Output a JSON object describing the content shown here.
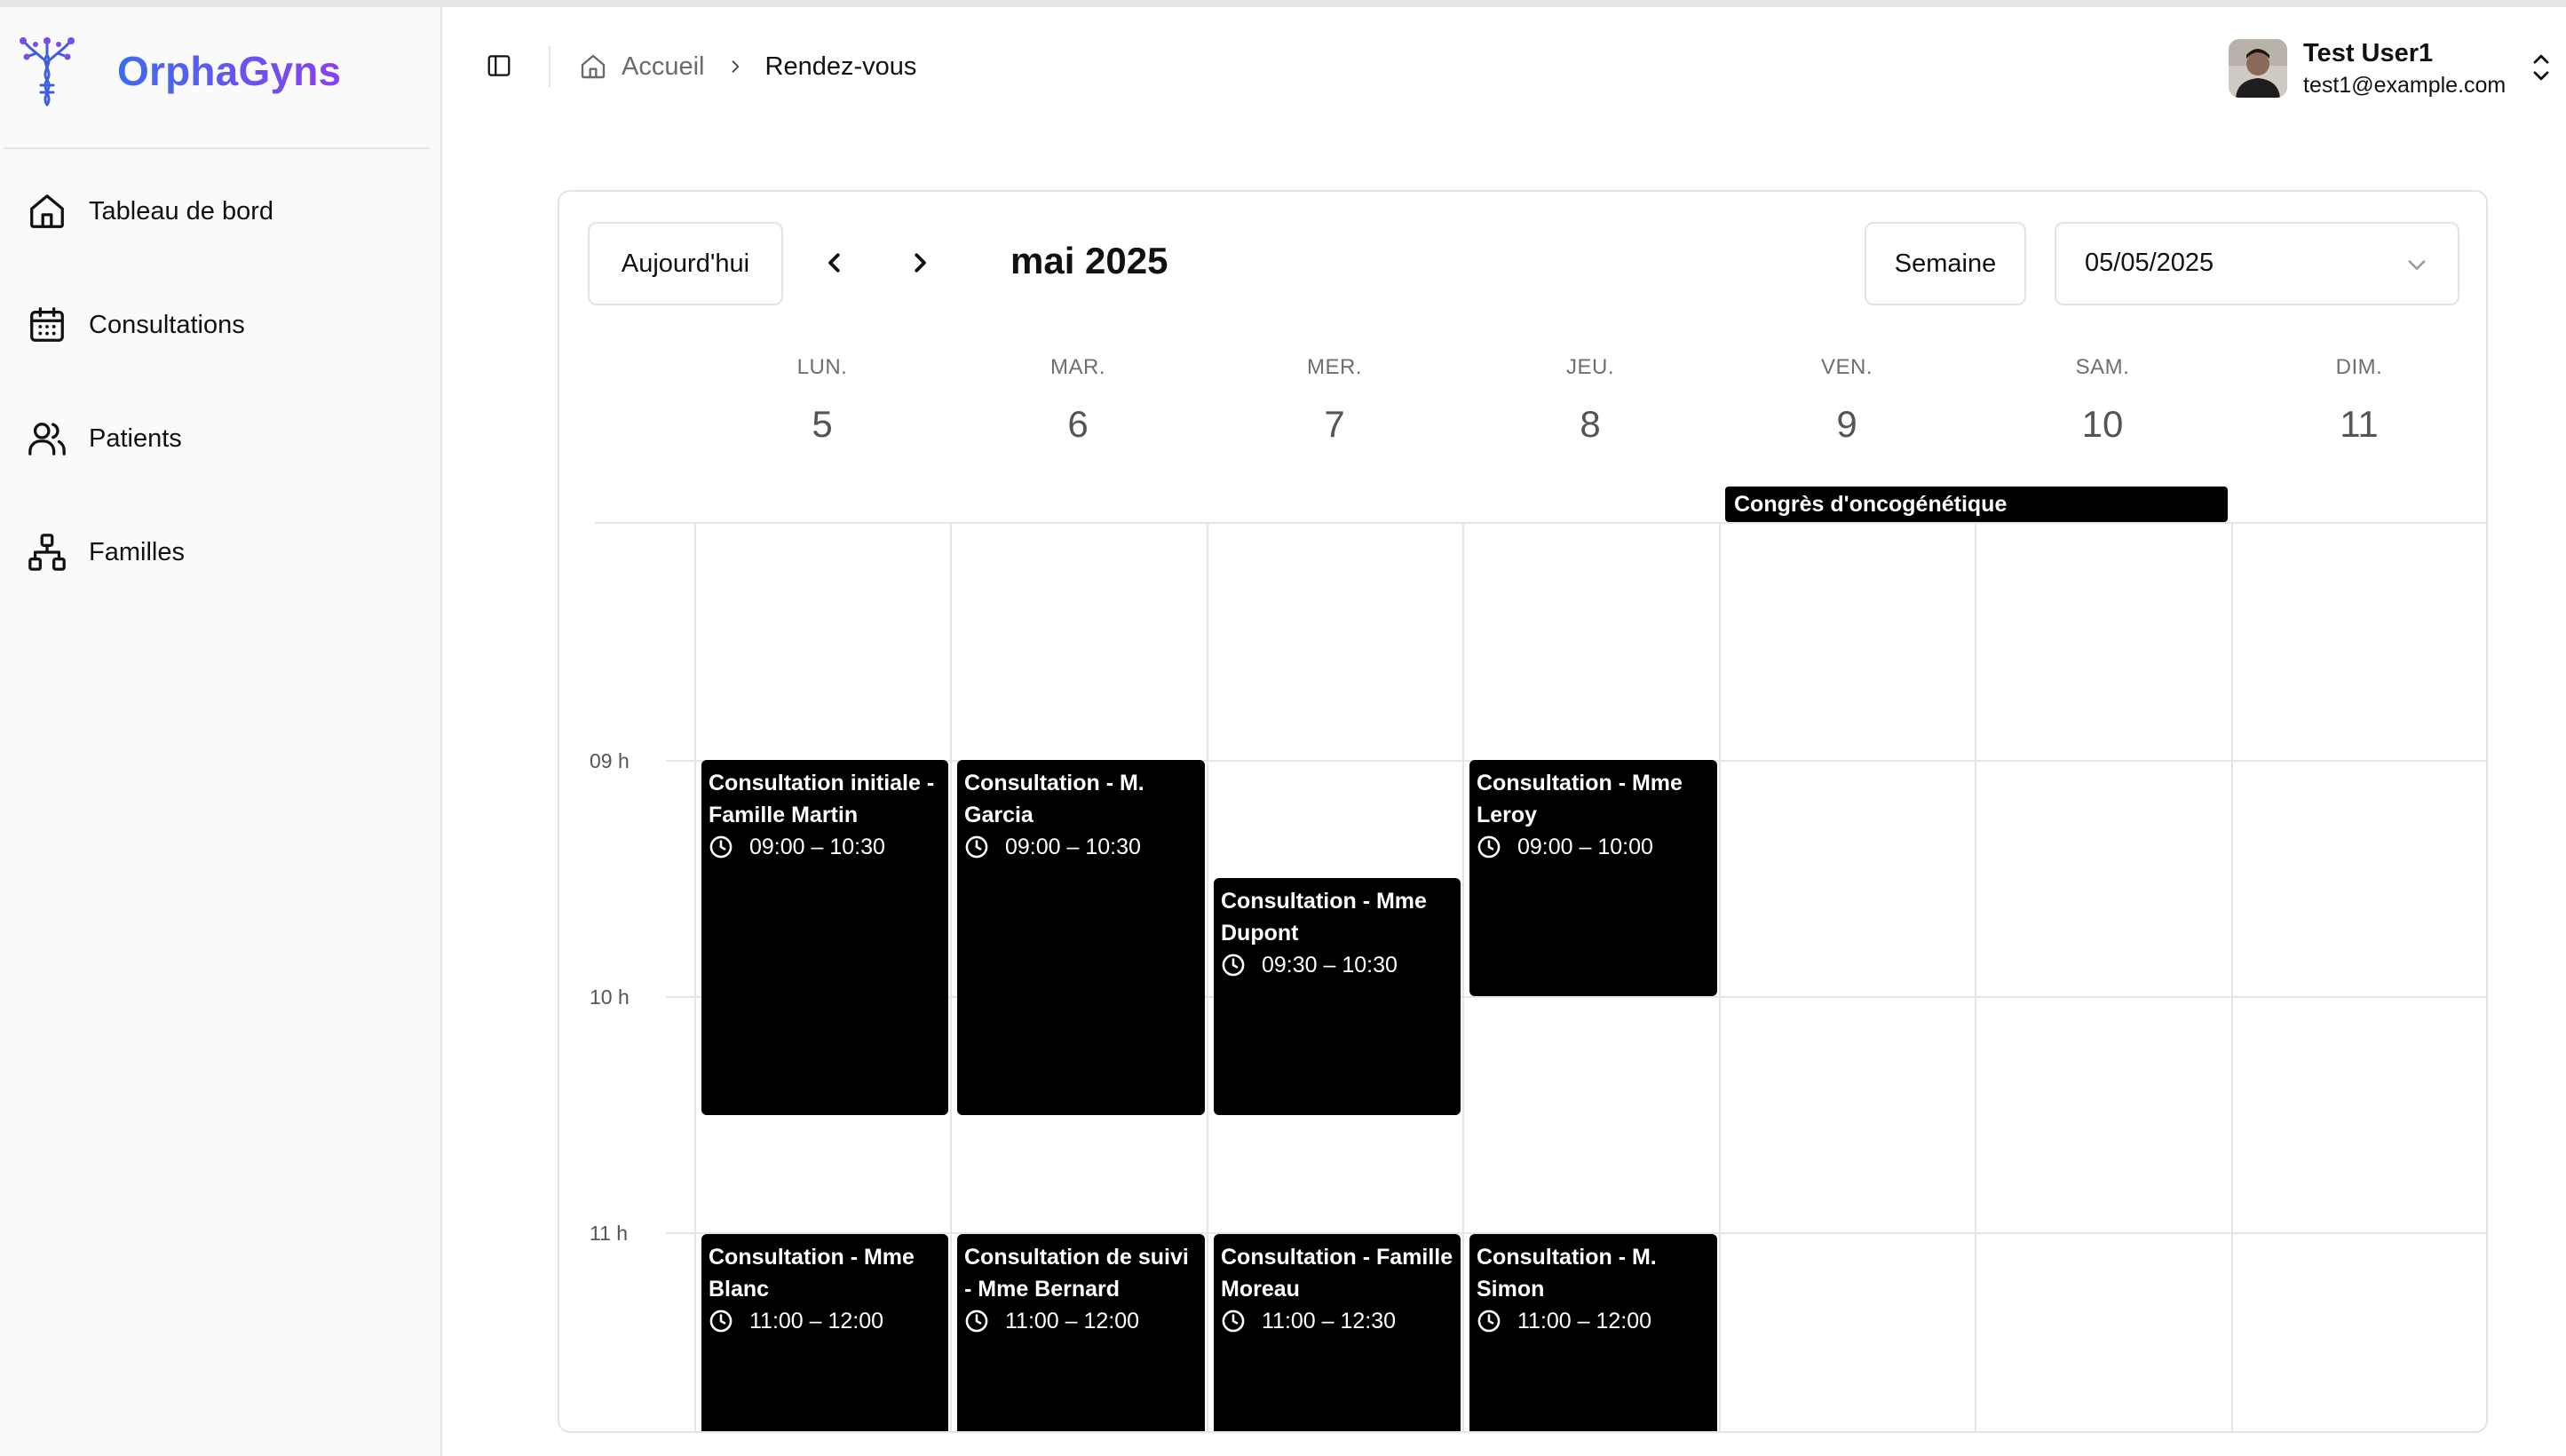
{
  "app": {
    "name": "OrphaGyns"
  },
  "sidebar": {
    "items": [
      {
        "label": "Tableau de bord",
        "icon": "home-icon"
      },
      {
        "label": "Consultations",
        "icon": "calendar-icon"
      },
      {
        "label": "Patients",
        "icon": "users-icon"
      },
      {
        "label": "Familles",
        "icon": "family-tree-icon"
      }
    ]
  },
  "header": {
    "breadcrumb": {
      "home": "Accueil",
      "current": "Rendez-vous"
    },
    "user": {
      "name": "Test User1",
      "email": "test1@example.com"
    }
  },
  "calendar": {
    "today_label": "Aujourd'hui",
    "month_title": "mai 2025",
    "view_label": "Semaine",
    "selected_date": "05/05/2025",
    "days": [
      {
        "dow": "LUN.",
        "num": "5"
      },
      {
        "dow": "MAR.",
        "num": "6"
      },
      {
        "dow": "MER.",
        "num": "7"
      },
      {
        "dow": "JEU.",
        "num": "8"
      },
      {
        "dow": "VEN.",
        "num": "9"
      },
      {
        "dow": "SAM.",
        "num": "10"
      },
      {
        "dow": "DIM.",
        "num": "11"
      }
    ],
    "hours": [
      "09 h",
      "10 h",
      "11 h"
    ],
    "all_day_event": {
      "title": "Congrès d'oncogénétique",
      "days": "VEN. 9 – SAM. 10"
    },
    "events": [
      {
        "title": "Consultation initiale - Famille Martin",
        "time": "09:00 – 10:30"
      },
      {
        "title": "Consultation - M. Garcia",
        "time": "09:00 – 10:30"
      },
      {
        "title": "Consultation - Mme Dupont",
        "time": "09:30 – 10:30"
      },
      {
        "title": "Consultation - Mme Leroy",
        "time": "09:00 – 10:00"
      },
      {
        "title": "Consultation - Mme Blanc",
        "time": "11:00 – 12:00"
      },
      {
        "title": "Consultation de suivi - Mme Bernard",
        "time": "11:00 – 12:00"
      },
      {
        "title": "Consultation - Famille Moreau",
        "time": "11:00 – 12:30"
      },
      {
        "title": "Consultation - M. Simon",
        "time": "11:00 – 12:00"
      }
    ]
  }
}
